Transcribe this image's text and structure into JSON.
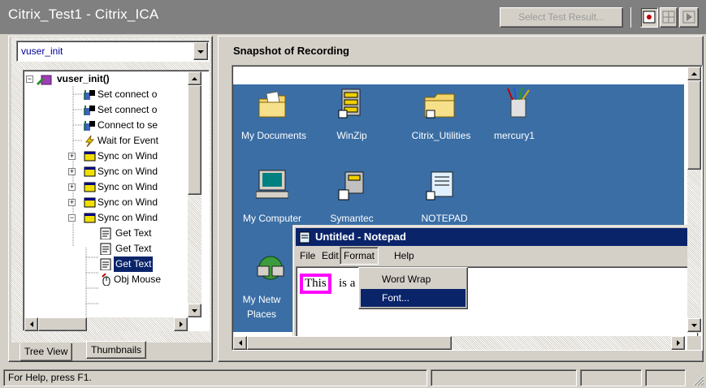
{
  "window": {
    "title": "Citrix_Test1 - Citrix_ICA"
  },
  "toolbar": {
    "select_test_result": "Select Test Result..."
  },
  "tree": {
    "combo_value": "vuser_init",
    "root": "vuser_init()",
    "items": [
      "Set connect o",
      "Set connect o",
      "Connect to se",
      "Wait for Event",
      "Sync on Wind",
      "Sync on Wind",
      "Sync on Wind",
      "Sync on Wind",
      "Sync on Wind",
      "Get Text",
      "Get Text",
      "Get Text",
      "Obj Mouse"
    ]
  },
  "tabs": {
    "tree_view": "Tree View",
    "thumbnails": "Thumbnails"
  },
  "snapshot": {
    "title": "Snapshot of Recording",
    "desktop_icons": [
      "My Documents",
      "WinZip",
      "Citrix_Utilities",
      "mercury1",
      "My Computer",
      "Symantec",
      "NOTEPAD",
      "My Netw",
      "Places"
    ]
  },
  "notepad": {
    "title": "Untitled - Notepad",
    "menu": {
      "file": "File",
      "edit": "Edit",
      "format": "Format",
      "help": "Help"
    },
    "text_highlight": "This",
    "text_rest": "is a",
    "dropdown": {
      "word_wrap": "Word Wrap",
      "font": "Font..."
    }
  },
  "statusbar": {
    "help": "For Help, press F1."
  },
  "colors": {
    "desktop": "#3a6ea5",
    "titlebar_active": "#0a246a",
    "highlight_box": "#ff00ff",
    "link_blue": "#00009c"
  }
}
